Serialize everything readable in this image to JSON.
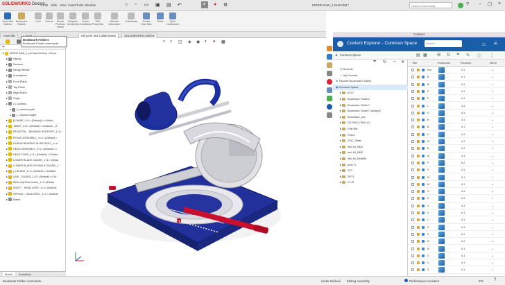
{
  "app": {
    "logo_brand": "SOLIDWORKS",
    "logo_product": "Design",
    "menus": [
      "File",
      "Edit",
      "View",
      "Insert",
      "Tools",
      "Window"
    ],
    "doc_title": "MITER SAW_1.SLDASM *",
    "search_placeholder": "Search Commands"
  },
  "ribbon": {
    "buttons": [
      {
        "label": "Save with Options",
        "icon": "save-icon",
        "color": "#2e6db4"
      },
      {
        "label": "Bookmark Folders",
        "icon": "bookmark-folder-icon",
        "color": "#c9a860"
      },
      {
        "label": "Lock",
        "icon": "lock-icon",
        "color": "#bbb"
      },
      {
        "label": "Unlock",
        "icon": "unlock-icon",
        "color": "#bbb"
      },
      {
        "label": "Revert Previous Owner",
        "icon": "revert-icon",
        "color": "#bbb"
      },
      {
        "label": "Request Ownership",
        "icon": "request-icon",
        "color": "#bbb"
      },
      {
        "label": "Check Conditions",
        "icon": "check-icon",
        "color": "#bbb"
      },
      {
        "label": "Edit Properties",
        "icon": "properties-icon",
        "color": "#bbb"
      },
      {
        "label": "Refresh Maturation",
        "icon": "refresh-icon",
        "color": "#bbb"
      },
      {
        "label": "Collaborate",
        "icon": "collaborate-icon",
        "color": "#bbb"
      },
      {
        "label": "Create New Task",
        "icon": "task-icon",
        "color": "#6a8ec0"
      },
      {
        "label": "Share",
        "icon": "share-icon",
        "color": "#6a8ec0"
      },
      {
        "label": "Open Dashboard",
        "icon": "dashboard-icon",
        "color": "#6a8ec0"
      }
    ]
  },
  "tabs": {
    "items": [
      "Assembly",
      "Layout",
      "Lifecycle and Collaboration",
      "SOLIDWORKS Add-ins"
    ],
    "active_index": 2
  },
  "tooltip": {
    "title": "Bookmark Folders",
    "body": "Bookmark Folder commands."
  },
  "tree": {
    "nodes": [
      {
        "label": "MITER SAW_1 (4-Head Motion) <All pa",
        "indent": 0,
        "color": "#f0c000"
      },
      {
        "label": "History",
        "indent": 1,
        "color": "#888"
      },
      {
        "label": "Sensors",
        "indent": 1,
        "color": "#888"
      },
      {
        "label": "Design Binder",
        "indent": 1,
        "color": "#888"
      },
      {
        "label": "Annotations",
        "indent": 1,
        "color": "#888"
      },
      {
        "label": "Front Plane",
        "indent": 1,
        "color": "#aaa"
      },
      {
        "label": "Top Plane",
        "indent": 1,
        "color": "#aaa"
      },
      {
        "label": "Right Plane",
        "indent": 1,
        "color": "#aaa"
      },
      {
        "label": "Origin",
        "indent": 1,
        "color": "#aaa"
      },
      {
        "label": "(-) Camera...",
        "indent": 1,
        "color": "#888"
      },
      {
        "label": "(-) camera path",
        "indent": 2,
        "color": "#888"
      },
      {
        "label": "(-) camera target",
        "indent": 2,
        "color": "#888"
      },
      {
        "label": "[S BASE_1<1> (Default) <<Defaul",
        "indent": 1,
        "color": "#e5b800"
      },
      {
        "label": "TABLE_1<1> (Default) <<Default> _A",
        "indent": 1,
        "color": "#e5b800"
      },
      {
        "label": "PEDESTAL - BEARING SUPPORT_1<1>",
        "indent": 1,
        "color": "#e5b800"
      },
      {
        "label": "FENCE ASSEMBLY_1<1> (Default) <",
        "indent": 1,
        "color": "#e5b800"
      },
      {
        "label": "LINEAR BEARING SLIDE ASSY_1<1>",
        "indent": 1,
        "color": "#e5b800"
      },
      {
        "label": "HEAD ASSEMBLY_1<1> (Default) <<",
        "indent": 1,
        "color": "#e5b800"
      },
      {
        "label": "HEAD YOKE_1<1> (Default) <<Defau",
        "indent": 1,
        "color": "#e5b800"
      },
      {
        "label": "LOWER BLADE GUARD_1<1> (Defau",
        "indent": 1,
        "color": "#e5b800"
      },
      {
        "label": "LOWER BLADE MOVABLE GUARD_1",
        "indent": 1,
        "color": "#e5b800"
      },
      {
        "label": "(-) BLADE_1<1> (Default) <<Default",
        "indent": 1,
        "color": "#e5b800"
      },
      {
        "label": "LINK - GUARD_1<2> (Default) <<De",
        "indent": 1,
        "color": "#e5b800"
      },
      {
        "label": "Micro Adj Pivot screw_1<1> (Defau",
        "indent": 1,
        "color": "#e5b800"
      },
      {
        "label": "SHAFT - HEAD ASSY_1<1> (Default",
        "indent": 1,
        "color": "#e5b800"
      },
      {
        "label": "SPRING - HEAD ASSY_1<1> (Default",
        "indent": 1,
        "color": "#e5b800"
      },
      {
        "label": "Mates",
        "indent": 1,
        "color": "#888"
      }
    ]
  },
  "bottomtabs": [
    "Model",
    "Animation"
  ],
  "status": {
    "left": "Bookmark Folder commands.",
    "mid1": "Under Defined",
    "mid2": "Editing Assembly",
    "right": "Performance Assistant",
    "units": "IPS",
    "right_icon": "help-icon"
  },
  "panel": {
    "header": "Content",
    "title": "Content Explorer - Common Space",
    "search_placeholder": "Search",
    "breadcrumb": "Common Space"
  },
  "folders": {
    "nodes": [
      {
        "label": "Recents",
        "indent": 1,
        "kind": "recent"
      },
      {
        "label": "My Content",
        "indent": 1,
        "kind": "user"
      },
      {
        "label": "Favorite Bookmark Folders",
        "indent": 0,
        "kind": "star"
      },
      {
        "label": "Common Space",
        "indent": 0,
        "kind": "space",
        "selected": true
      },
      {
        "label": "AT47",
        "indent": 1,
        "kind": "folder"
      },
      {
        "label": "Bookmark Folder2",
        "indent": 1,
        "kind": "folder"
      },
      {
        "label": "Bookmark Folder7",
        "indent": 1,
        "kind": "folder"
      },
      {
        "label": "Bookmark Folder7-Idesign2",
        "indent": 1,
        "kind": "folder"
      },
      {
        "label": "Bookmark_prt2",
        "indent": 1,
        "kind": "folder"
      },
      {
        "label": "DS DRV-17626-01",
        "indent": 1,
        "kind": "folder"
      },
      {
        "label": "FAB BM",
        "indent": 1,
        "kind": "folder"
      },
      {
        "label": "FMC2",
        "indent": 1,
        "kind": "folder"
      },
      {
        "label": "GNC_Slate",
        "indent": 1,
        "kind": "folder"
      },
      {
        "label": "mfd 16_BM1",
        "indent": 1,
        "kind": "folder"
      },
      {
        "label": "mfd 18_BM2",
        "indent": 1,
        "kind": "folder"
      },
      {
        "label": "mfd 16_ResBM",
        "indent": 1,
        "kind": "folder"
      },
      {
        "label": "prt17-1",
        "indent": 1,
        "kind": "folder"
      },
      {
        "label": "SJ7",
        "indent": 1,
        "kind": "folder"
      },
      {
        "label": "SPT1",
        "indent": 1,
        "kind": "folder"
      },
      {
        "label": "YLJ5",
        "indent": 1,
        "kind": "folder"
      }
    ]
  },
  "grid": {
    "columns": [
      "Title",
      "Thumbnail",
      "Revision",
      "Menu"
    ],
    "rows": [
      {
        "title": "fore",
        "revision": "A.1"
      },
      {
        "title": "B",
        "revision": "A.1"
      },
      {
        "title": "B",
        "revision": "A.1"
      },
      {
        "title": "P",
        "revision": "A.1"
      },
      {
        "title": "P",
        "revision": "A.1"
      },
      {
        "title": "L",
        "revision": "A.1"
      },
      {
        "title": "S",
        "revision": "A.1"
      },
      {
        "title": "B",
        "revision": "A.1"
      },
      {
        "title": "B",
        "revision": "A.1"
      },
      {
        "title": "H",
        "revision": "A.1"
      },
      {
        "title": "M",
        "revision": "A.1"
      },
      {
        "title": "B",
        "revision": "A.1"
      },
      {
        "title": "M",
        "revision": "A.1"
      },
      {
        "title": "P",
        "revision": "A.2"
      },
      {
        "title": "S",
        "revision": "A.1"
      },
      {
        "title": "M",
        "revision": "A.1"
      },
      {
        "title": "M",
        "revision": "A.1"
      },
      {
        "title": "S",
        "revision": "A.1"
      },
      {
        "title": "S",
        "revision": "A.1"
      },
      {
        "title": "S",
        "revision": "A.1"
      },
      {
        "title": "S",
        "revision": "A.1"
      },
      {
        "title": "C",
        "revision": "A.1"
      },
      {
        "title": "S",
        "revision": "A.1"
      },
      {
        "title": "S",
        "revision": "A.1"
      },
      {
        "title": "M",
        "revision": "A.1"
      },
      {
        "title": "M",
        "revision": "A.1"
      },
      {
        "title": "S",
        "revision": "A.1"
      },
      {
        "title": "S",
        "revision": "A.1"
      },
      {
        "title": "S",
        "revision": "A.1"
      }
    ]
  },
  "colors": {
    "accent": "#1a5ea8",
    "model_blue": "#1b2f9e",
    "model_red": "#c8102e",
    "thumb_blue": "#3a86d4"
  }
}
